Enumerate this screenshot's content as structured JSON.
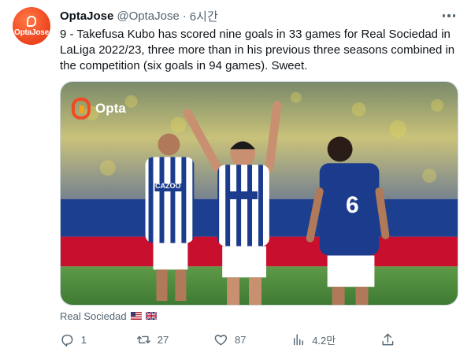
{
  "tweet": {
    "avatar_text": "OptaJose",
    "display_name": "OptaJose",
    "handle": "@OptaJose",
    "separator": "·",
    "time": "6시간",
    "text": "9 - Takefusa Kubo has scored nine goals in 33 games for Real Sociedad in LaLiga 2022/23, three more than in his previous three seasons combined in the competition (six goals in 94 games). Sweet."
  },
  "media": {
    "watermark": "Opta",
    "jersey_sponsor": "CAZOO",
    "jersey_number": "6"
  },
  "caption": {
    "text": "Real Sociedad",
    "flags": [
      "us-flag",
      "uk-flag"
    ]
  },
  "actions": {
    "reply": {
      "icon": "reply-icon",
      "count": "1"
    },
    "retweet": {
      "icon": "retweet-icon",
      "count": "27"
    },
    "like": {
      "icon": "heart-icon",
      "count": "87"
    },
    "views": {
      "icon": "views-icon",
      "count": "4.2만"
    },
    "share": {
      "icon": "share-icon",
      "count": ""
    }
  },
  "colors": {
    "text_primary": "#0f1419",
    "text_secondary": "#536471",
    "border": "#cfd9de",
    "opta_orange": "#f04a23",
    "sociedad_blue": "#1b3c8c"
  }
}
